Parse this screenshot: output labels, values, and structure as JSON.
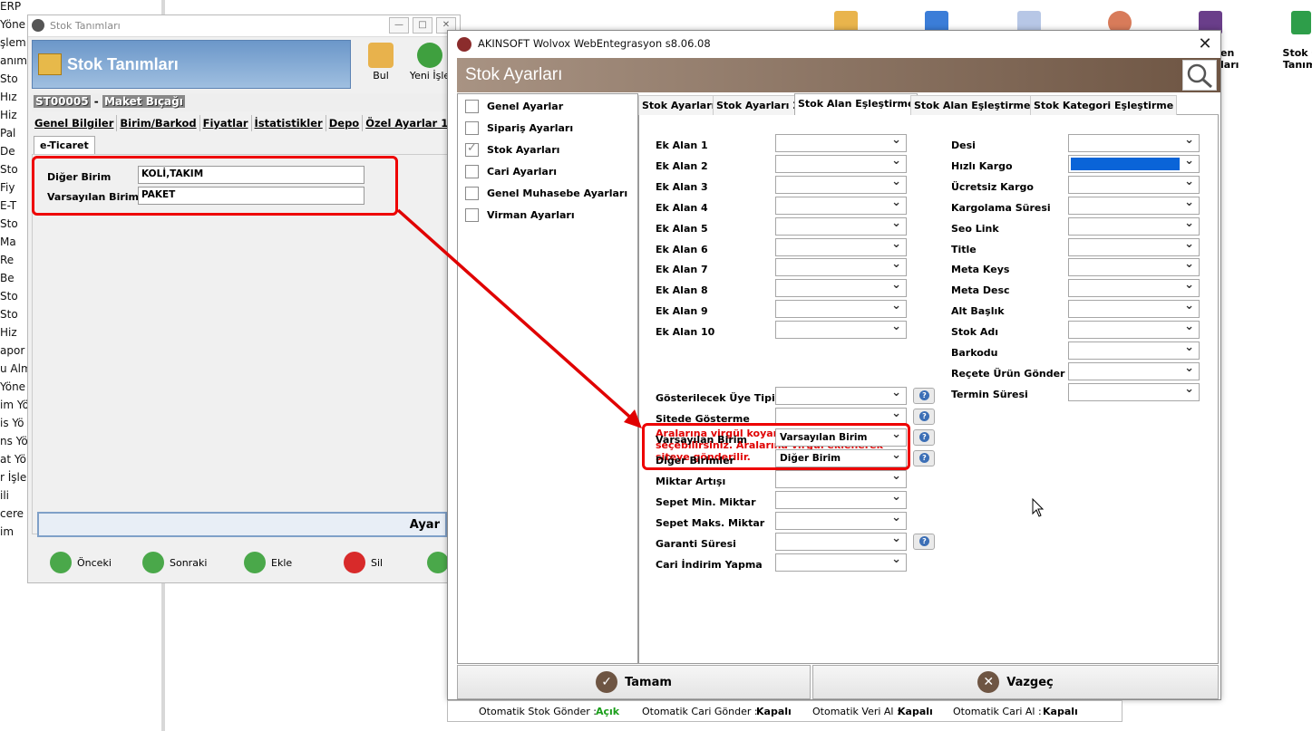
{
  "tree": {
    "items": [
      "ERP",
      "Yöne",
      "şlem",
      "anım",
      "Sto",
      "Hız",
      "Hiz",
      "Pal",
      "De",
      "Sto",
      "Fiy",
      "E-T",
      "Sto",
      "Ma",
      "Re",
      "Be",
      "Sto",
      "Sto",
      "Hiz",
      "apor",
      "u Alm",
      "Yöne",
      "im Yö",
      "is Yö",
      "ns Yö",
      "at Yö",
      "r İşle",
      "ili",
      "cere",
      "im"
    ]
  },
  "desktop": {
    "label_1": "en\nları",
    "label_2": "Stok G\nTanıml"
  },
  "stok_window": {
    "title": "Stok Tanımları",
    "header_title": "Stok Tanımları",
    "toolbar": {
      "find": "Bul",
      "new": "Yeni İşle"
    },
    "code": "ST00005",
    "dash": "-",
    "product_name": "Maket Bıçağı",
    "tabs": [
      "Genel Bilgiler",
      "Birim/Barkod",
      "Fiyatlar",
      "İstatistikler",
      "Depo",
      "Özel Ayarlar 1",
      "Özel A"
    ],
    "subtab": "e-Ticaret",
    "fields": {
      "diger_birim_label": "Diğer Birim",
      "diger_birim_value": "KOLİ,TAKIM",
      "varsayilan_birim_label": "Varsayılan Birim",
      "varsayilan_birim_value": "PAKET"
    },
    "ayar": "Ayar",
    "nav": {
      "prev": "Önceki",
      "next": "Sonraki",
      "add": "Ekle",
      "delete": "Sil"
    }
  },
  "dialog": {
    "title": "AKINSOFT Wolvox WebEntegrasyon s8.06.08",
    "close": "✕",
    "header": "Stok Ayarları",
    "left_items": [
      {
        "label": "Genel Ayarlar",
        "checked": false
      },
      {
        "label": "Sipariş Ayarları",
        "checked": false
      },
      {
        "label": "Stok Ayarları",
        "checked": true
      },
      {
        "label": "Cari Ayarları",
        "checked": false
      },
      {
        "label": "Genel Muhasebe Ayarları",
        "checked": false
      },
      {
        "label": "Virman Ayarları",
        "checked": false
      }
    ],
    "tabs": [
      "Stok Ayarları",
      "Stok Ayarları 2",
      "Stok Alan Eşleştirme",
      "Stok Alan Eşleştirme 2",
      "Stok Kategori Eşleştirme"
    ],
    "active_tab": "Stok Alan Eşleştirme",
    "left_fields": [
      "Ek Alan 1",
      "Ek Alan 2",
      "Ek Alan 3",
      "Ek Alan 4",
      "Ek Alan 5",
      "Ek Alan 6",
      "Ek Alan 7",
      "Ek Alan 8",
      "Ek Alan 9",
      "Ek Alan 10"
    ],
    "note": "Aralarına virgül koyarak birden fazla alan seçebilirsiniz. Aralarına virgül  eklenerek siteye gönderilir.",
    "lower_fields": [
      {
        "label": "Gösterilecek Üye Tipi",
        "value": "",
        "help": true
      },
      {
        "label": "Sitede Gösterme",
        "value": "",
        "help": true
      },
      {
        "label": "Varsayılan Birim",
        "value": "Varsayılan Birim",
        "help": true
      },
      {
        "label": "Diğer Birimler",
        "value": "Diğer Birim",
        "help": true
      },
      {
        "label": "Miktar Artışı",
        "value": "",
        "help": false
      },
      {
        "label": "Sepet Min. Miktar",
        "value": "",
        "help": false
      },
      {
        "label": "Sepet Maks. Miktar",
        "value": "",
        "help": false
      },
      {
        "label": "Garanti Süresi",
        "value": "",
        "help": true
      },
      {
        "label": "Cari İndirim Yapma",
        "value": "",
        "help": false
      }
    ],
    "right_fields": [
      "Desi",
      "Hızlı Kargo",
      "Ücretsiz Kargo",
      "Kargolama Süresi",
      "Seo Link",
      "Title",
      "Meta Keys",
      "Meta Desc",
      "Alt Başlık",
      "Stok Adı",
      "Barkodu",
      "Reçete Ürün Gönder",
      "Termin Süresi"
    ],
    "ok": "Tamam",
    "cancel": "Vazgeç"
  },
  "statusbar": {
    "stok_label": "Otomatik Stok Gönder :",
    "stok_value": "Açık",
    "cari_label": "Otomatik Cari Gönder :",
    "cari_value": "Kapalı",
    "veri_label": "Otomatik Veri Al :",
    "veri_value": "Kapalı",
    "cari_al_label": "Otomatik Cari Al :",
    "cari_al_value": "Kapalı"
  },
  "colors": {
    "highlight_red": "#e00000",
    "header_brown": "#6e5543",
    "stok_blue": "#6b97c9",
    "selection_blue": "#0a64d8"
  }
}
